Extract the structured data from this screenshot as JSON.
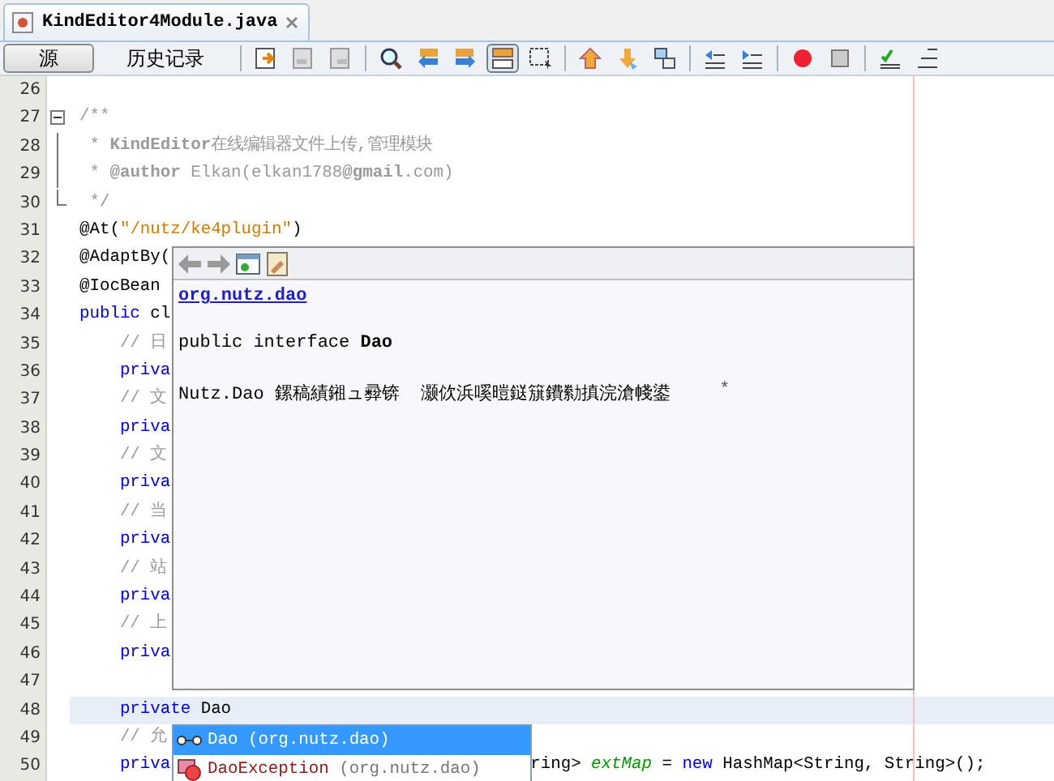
{
  "file_tab": {
    "title": "KindEditor4Module.java"
  },
  "view_tabs": [
    {
      "label": "源",
      "selected": true
    },
    {
      "label": "历史记录",
      "selected": false
    }
  ],
  "editor": {
    "lines": [
      {
        "number": "26",
        "kind": "code",
        "highlighted": false
      },
      {
        "number": "27",
        "kind": "fold-start",
        "highlighted": false,
        "segments": [
          {
            "kind": "comment",
            "text": "/**"
          }
        ]
      },
      {
        "number": "28",
        "kind": "fold-body",
        "highlighted": false,
        "segments": [
          {
            "kind": "comment",
            "text": " * "
          },
          {
            "kind": "doctag",
            "text": "KindEditor"
          },
          {
            "kind": "comment",
            "text": "在线编辑器文件上传,管理模块"
          }
        ]
      },
      {
        "number": "29",
        "kind": "fold-body",
        "highlighted": false,
        "segments": [
          {
            "kind": "comment",
            "text": " * "
          },
          {
            "kind": "doctag",
            "text": "@author"
          },
          {
            "kind": "comment",
            "text": " Elkan(elkan1788"
          },
          {
            "kind": "doctag",
            "text": "@gmail"
          },
          {
            "kind": "comment",
            "text": ".com)"
          }
        ]
      },
      {
        "number": "30",
        "kind": "fold-end",
        "highlighted": false,
        "segments": [
          {
            "kind": "comment",
            "text": " */"
          }
        ]
      },
      {
        "number": "31",
        "kind": "code",
        "highlighted": false,
        "segments": [
          {
            "kind": "plain",
            "text": "@At("
          },
          {
            "kind": "string",
            "text": "\"/nutz/ke4plugin\""
          },
          {
            "kind": "plain",
            "text": ")"
          }
        ]
      },
      {
        "number": "32",
        "kind": "code",
        "highlighted": false,
        "segments": [
          {
            "kind": "plain",
            "text": "@AdaptBy("
          }
        ]
      },
      {
        "number": "33",
        "kind": "code",
        "highlighted": false,
        "segments": [
          {
            "kind": "plain",
            "text": "@IocBean"
          }
        ]
      },
      {
        "number": "34",
        "kind": "code",
        "highlighted": false,
        "segments": [
          {
            "kind": "keyword",
            "text": "public"
          },
          {
            "kind": "plain",
            "text": " cl"
          }
        ]
      },
      {
        "number": "35",
        "kind": "code",
        "highlighted": false,
        "segments": [
          {
            "kind": "comment",
            "text": "    // 日"
          }
        ]
      },
      {
        "number": "36",
        "kind": "code",
        "highlighted": false,
        "segments": [
          {
            "kind": "keyword",
            "text": "    priva"
          }
        ]
      },
      {
        "number": "37",
        "kind": "code",
        "highlighted": false,
        "segments": [
          {
            "kind": "comment",
            "text": "    // 文"
          }
        ]
      },
      {
        "number": "38",
        "kind": "code",
        "highlighted": false,
        "segments": [
          {
            "kind": "keyword",
            "text": "    priva"
          }
        ]
      },
      {
        "number": "39",
        "kind": "code",
        "highlighted": false,
        "segments": [
          {
            "kind": "comment",
            "text": "    // 文"
          }
        ]
      },
      {
        "number": "40",
        "kind": "code",
        "highlighted": false,
        "segments": [
          {
            "kind": "keyword",
            "text": "    priva"
          }
        ]
      },
      {
        "number": "41",
        "kind": "code",
        "highlighted": false,
        "segments": [
          {
            "kind": "comment",
            "text": "    // 当"
          }
        ]
      },
      {
        "number": "42",
        "kind": "code",
        "highlighted": false,
        "segments": [
          {
            "kind": "keyword",
            "text": "    priva"
          }
        ]
      },
      {
        "number": "43",
        "kind": "code",
        "highlighted": false,
        "segments": [
          {
            "kind": "comment",
            "text": "    // 站"
          }
        ]
      },
      {
        "number": "44",
        "kind": "code",
        "highlighted": false,
        "segments": [
          {
            "kind": "keyword",
            "text": "    priva"
          }
        ]
      },
      {
        "number": "45",
        "kind": "code",
        "highlighted": false,
        "segments": [
          {
            "kind": "comment",
            "text": "    // 上"
          }
        ]
      },
      {
        "number": "46",
        "kind": "code",
        "highlighted": false,
        "segments": [
          {
            "kind": "keyword",
            "text": "    priva"
          }
        ]
      },
      {
        "number": "47",
        "kind": "code",
        "highlighted": false
      },
      {
        "number": "48",
        "kind": "code",
        "highlighted": true,
        "segments": [
          {
            "kind": "keyword",
            "text": "    private"
          },
          {
            "kind": "plain",
            "text": " Dao"
          }
        ]
      },
      {
        "number": "49",
        "kind": "code",
        "highlighted": false,
        "segments": [
          {
            "kind": "comment",
            "text": "    // 允"
          }
        ]
      },
      {
        "number": "50",
        "kind": "code",
        "highlighted": false,
        "segments": [
          {
            "kind": "keyword",
            "text": "    priva"
          }
        ],
        "tail_segments": [
          {
            "kind": "plain",
            "text": "ring> "
          },
          {
            "kind": "field",
            "text": "extMap"
          },
          {
            "kind": "plain",
            "text": " = "
          },
          {
            "kind": "keyword",
            "text": "new"
          },
          {
            "kind": "plain",
            "text": " HashMap<String, String>();"
          }
        ]
      }
    ]
  },
  "doc_popup": {
    "package_link": "org.nutz.dao",
    "signature": "public interface **Dao**",
    "description": "Nutz.Dao 鏍稿績鎺ュ彛锛  灏佽浜嗘暟鎹簱鐨勬搷浣滄帴鍙",
    "marker": "*"
  },
  "completion": {
    "items": [
      {
        "kind": "interface",
        "name": "Dao",
        "package": "(org.nutz.dao)",
        "selected": true
      },
      {
        "kind": "exception",
        "name": "DaoException",
        "package": "(org.nutz.dao)",
        "selected": false
      }
    ]
  }
}
